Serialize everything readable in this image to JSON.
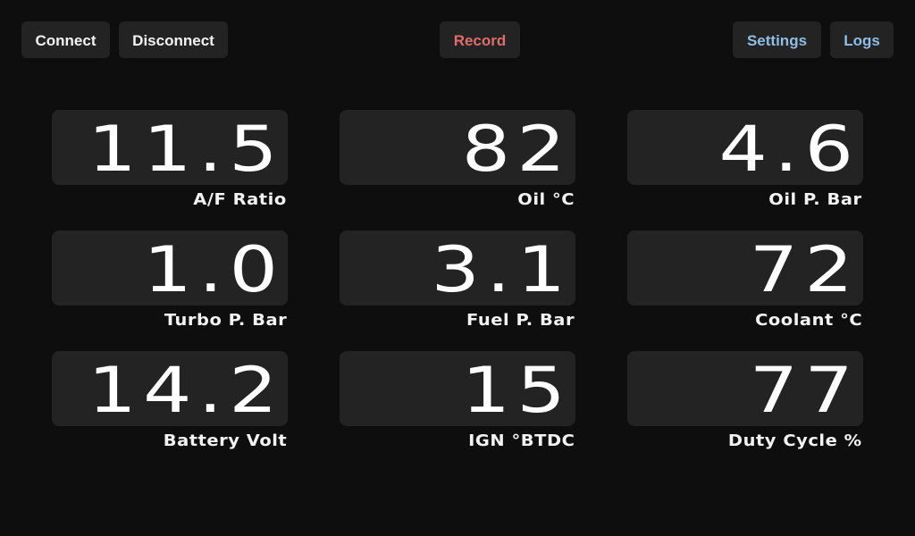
{
  "toolbar": {
    "connect_label": "Connect",
    "disconnect_label": "Disconnect",
    "record_label": "Record",
    "settings_label": "Settings",
    "logs_label": "Logs"
  },
  "gauges": [
    {
      "value": "11.5",
      "label": "A/F Ratio"
    },
    {
      "value": "82",
      "label": "Oil °C"
    },
    {
      "value": "4.6",
      "label": "Oil P. Bar"
    },
    {
      "value": "1.0",
      "label": "Turbo P. Bar"
    },
    {
      "value": "3.1",
      "label": "Fuel P. Bar"
    },
    {
      "value": "72",
      "label": "Coolant °C"
    },
    {
      "value": "14.2",
      "label": "Battery Volt"
    },
    {
      "value": "15",
      "label": "IGN °BTDC"
    },
    {
      "value": "77",
      "label": "Duty Cycle %"
    }
  ],
  "colors": {
    "background": "#0e0e0e",
    "panel": "#232323",
    "text": "#f2f2f2",
    "record_accent": "#e06c6c",
    "link_accent": "#8fbde6"
  }
}
